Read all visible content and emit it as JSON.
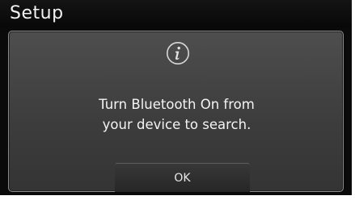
{
  "header": {
    "title": "Setup"
  },
  "popup": {
    "icon": "info-icon",
    "message_line1": "Turn Bluetooth On from",
    "message_line2": "your device to search.",
    "ok_label": "OK"
  },
  "colors": {
    "screen_background": "#0a0a0a",
    "popup_background": "#444444",
    "popup_border": "#8c8c8c",
    "text": "#f4f4f4"
  }
}
